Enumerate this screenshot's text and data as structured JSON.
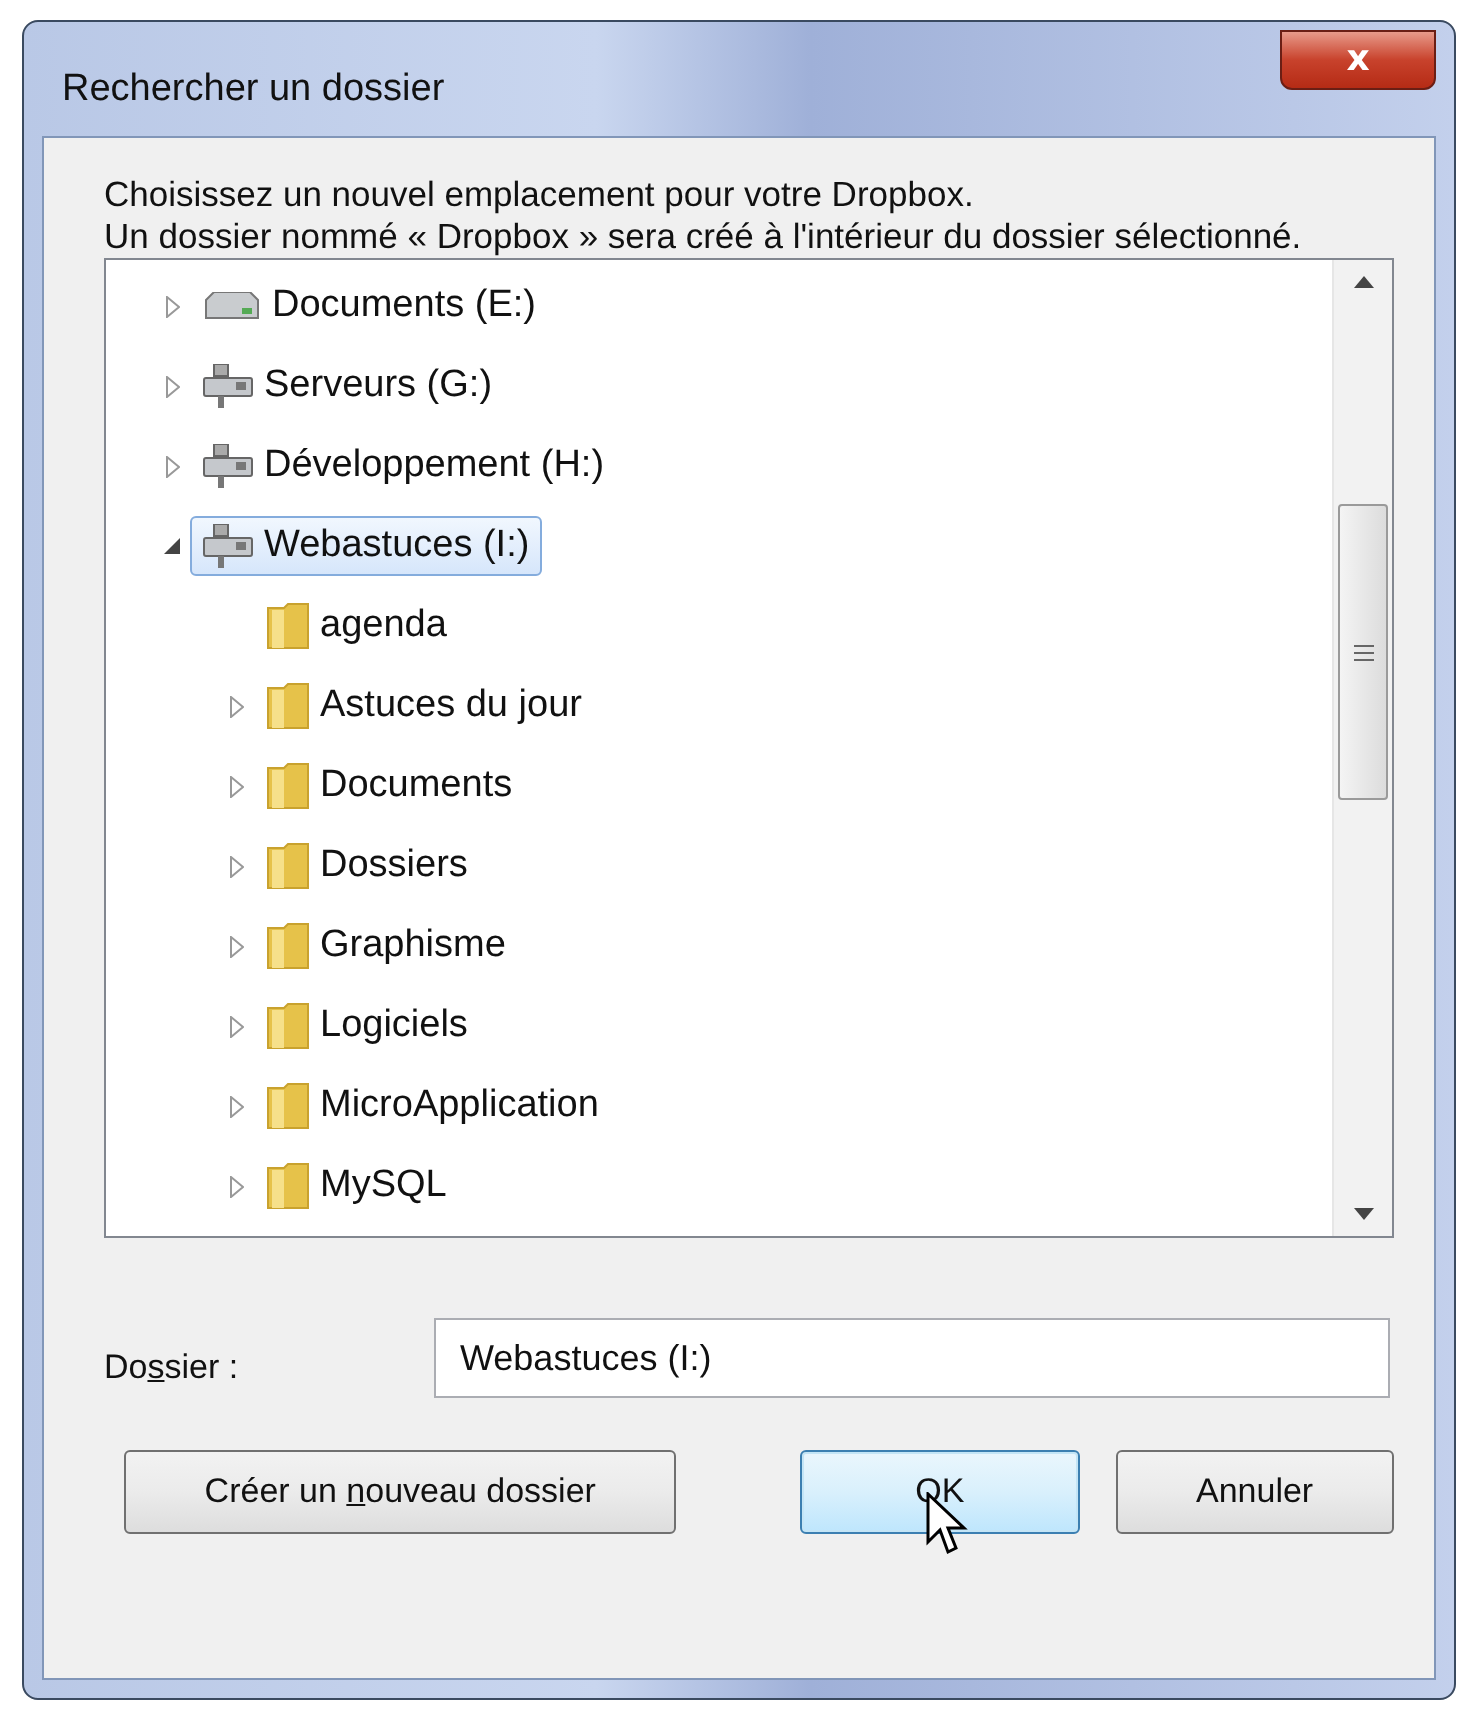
{
  "window": {
    "title": "Rechercher un dossier",
    "close_glyph": "x"
  },
  "description": [
    "Choisissez un nouvel emplacement pour votre Dropbox.",
    "Un dossier nommé « Dropbox » sera créé à l'intérieur du dossier sélectionné."
  ],
  "tree": {
    "items": [
      {
        "label": "Documents (E:)",
        "kind": "drive",
        "expanded": false,
        "selected": false
      },
      {
        "label": "Serveurs (G:)",
        "kind": "network_drive",
        "expanded": false,
        "selected": false
      },
      {
        "label": "Développement (H:)",
        "kind": "network_drive",
        "expanded": false,
        "selected": false
      },
      {
        "label": "Webastuces (I:)",
        "kind": "network_drive",
        "expanded": true,
        "selected": true,
        "children": [
          {
            "label": "agenda",
            "kind": "folder",
            "has_children": false,
            "selected": false
          },
          {
            "label": "Astuces du jour",
            "kind": "folder",
            "expanded": false,
            "selected": false
          },
          {
            "label": "Documents",
            "kind": "folder",
            "expanded": false,
            "selected": false
          },
          {
            "label": "Dossiers",
            "kind": "folder",
            "expanded": false,
            "selected": false
          },
          {
            "label": "Graphisme",
            "kind": "folder",
            "expanded": false,
            "selected": false
          },
          {
            "label": "Logiciels",
            "kind": "folder",
            "expanded": false,
            "selected": false
          },
          {
            "label": "MicroApplication",
            "kind": "folder",
            "expanded": false,
            "selected": false
          },
          {
            "label": "MySQL",
            "kind": "folder",
            "expanded": false,
            "selected": false
          }
        ]
      }
    ]
  },
  "folder_field": {
    "label_parts": [
      "Do",
      "s",
      "sier :"
    ],
    "value": "Webastuces (I:)"
  },
  "buttons": [
    {
      "label_parts": [
        "Créer un ",
        "n",
        "ouveau dossier"
      ],
      "default": false,
      "hovered": false
    },
    {
      "label_parts": [
        "OK"
      ],
      "default": true,
      "hovered": true
    },
    {
      "label_parts": [
        "Annuler"
      ],
      "default": false,
      "hovered": false
    }
  ]
}
